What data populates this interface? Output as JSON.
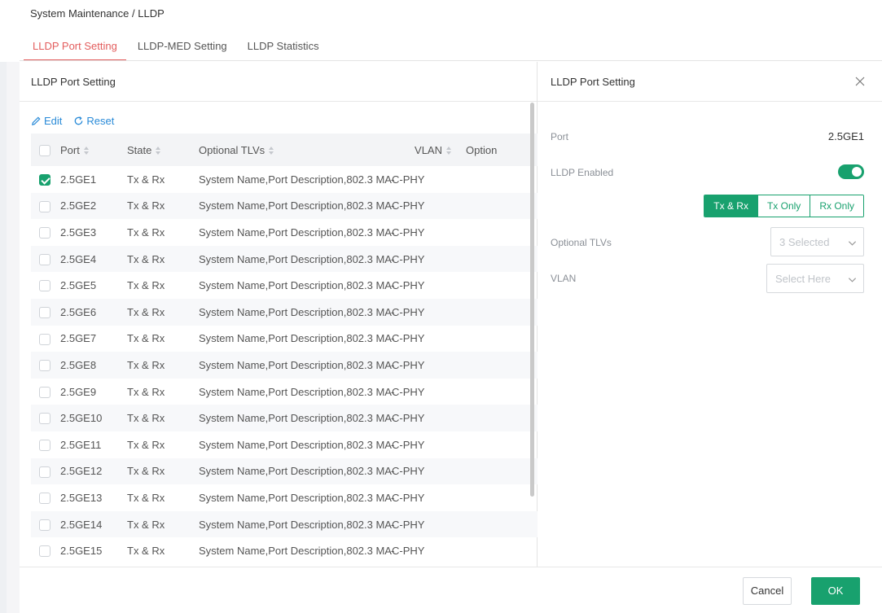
{
  "breadcrumb": "System Maintenance / LLDP",
  "tabs": [
    {
      "label": "LLDP Port Setting",
      "active": true
    },
    {
      "label": "LLDP-MED Setting",
      "active": false
    },
    {
      "label": "LLDP Statistics",
      "active": false
    }
  ],
  "panel": {
    "title": "LLDP Port Setting",
    "toolbar": {
      "edit_label": "Edit",
      "reset_label": "Reset"
    },
    "columns": {
      "port": "Port",
      "state": "State",
      "tlvs": "Optional TLVs",
      "vlan": "VLAN",
      "option": "Option"
    },
    "rows": [
      {
        "port": "2.5GE1",
        "state": "Tx & Rx",
        "tlvs": "System Name,Port Description,802.3 MAC-PHY",
        "vlan": "-",
        "checked": true
      },
      {
        "port": "2.5GE2",
        "state": "Tx & Rx",
        "tlvs": "System Name,Port Description,802.3 MAC-PHY",
        "vlan": "-",
        "checked": false
      },
      {
        "port": "2.5GE3",
        "state": "Tx & Rx",
        "tlvs": "System Name,Port Description,802.3 MAC-PHY",
        "vlan": "-",
        "checked": false
      },
      {
        "port": "2.5GE4",
        "state": "Tx & Rx",
        "tlvs": "System Name,Port Description,802.3 MAC-PHY",
        "vlan": "-",
        "checked": false
      },
      {
        "port": "2.5GE5",
        "state": "Tx & Rx",
        "tlvs": "System Name,Port Description,802.3 MAC-PHY",
        "vlan": "-",
        "checked": false
      },
      {
        "port": "2.5GE6",
        "state": "Tx & Rx",
        "tlvs": "System Name,Port Description,802.3 MAC-PHY",
        "vlan": "-",
        "checked": false
      },
      {
        "port": "2.5GE7",
        "state": "Tx & Rx",
        "tlvs": "System Name,Port Description,802.3 MAC-PHY",
        "vlan": "-",
        "checked": false
      },
      {
        "port": "2.5GE8",
        "state": "Tx & Rx",
        "tlvs": "System Name,Port Description,802.3 MAC-PHY",
        "vlan": "-",
        "checked": false
      },
      {
        "port": "2.5GE9",
        "state": "Tx & Rx",
        "tlvs": "System Name,Port Description,802.3 MAC-PHY",
        "vlan": "-",
        "checked": false
      },
      {
        "port": "2.5GE10",
        "state": "Tx & Rx",
        "tlvs": "System Name,Port Description,802.3 MAC-PHY",
        "vlan": "-",
        "checked": false
      },
      {
        "port": "2.5GE11",
        "state": "Tx & Rx",
        "tlvs": "System Name,Port Description,802.3 MAC-PHY",
        "vlan": "-",
        "checked": false
      },
      {
        "port": "2.5GE12",
        "state": "Tx & Rx",
        "tlvs": "System Name,Port Description,802.3 MAC-PHY",
        "vlan": "-",
        "checked": false
      },
      {
        "port": "2.5GE13",
        "state": "Tx & Rx",
        "tlvs": "System Name,Port Description,802.3 MAC-PHY",
        "vlan": "-",
        "checked": false
      },
      {
        "port": "2.5GE14",
        "state": "Tx & Rx",
        "tlvs": "System Name,Port Description,802.3 MAC-PHY",
        "vlan": "-",
        "checked": false
      },
      {
        "port": "2.5GE15",
        "state": "Tx & Rx",
        "tlvs": "System Name,Port Description,802.3 MAC-PHY",
        "vlan": "-",
        "checked": false
      }
    ]
  },
  "side": {
    "title": "LLDP Port Setting",
    "port_label": "Port",
    "port_value": "2.5GE1",
    "enabled_label": "LLDP Enabled",
    "enabled": true,
    "mode_options": [
      "Tx & Rx",
      "Tx Only",
      "Rx Only"
    ],
    "mode_selected": "Tx & Rx",
    "tlvs_label": "Optional TLVs",
    "tlvs_value": "3 Selected",
    "vlan_label": "VLAN",
    "vlan_placeholder": "Select Here",
    "cancel_label": "Cancel",
    "ok_label": "OK"
  },
  "colors": {
    "accent": "#18a16e",
    "tab_active": "#e35d5d",
    "link": "#2a8bd8"
  }
}
